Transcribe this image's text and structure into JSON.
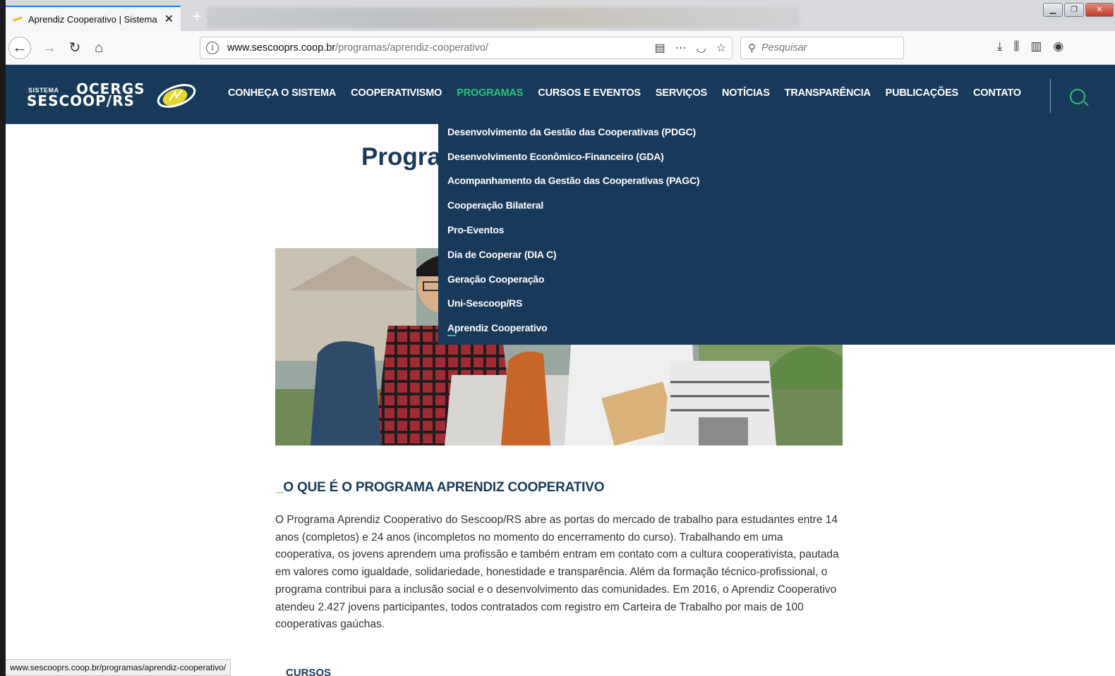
{
  "browser": {
    "tab_title": "Aprendiz Cooperativo | Sistema",
    "new_tab_label": "+",
    "url_domain": "www.sescooprs.coop.br",
    "url_path": "/programas/aprendiz-cooperativo/",
    "search_placeholder": "Pesquisar",
    "status_url": "www.sescooprs.coop.br/programas/aprendiz-cooperativo/"
  },
  "site": {
    "logo": {
      "sistema": "SISTEMA",
      "ocergs": "OCERGS",
      "sescoop": "SESCOOP/RS"
    },
    "nav": [
      {
        "label": "CONHEÇA O SISTEMA"
      },
      {
        "label": "COOPERATIVISMO"
      },
      {
        "label": "PROGRAMAS"
      },
      {
        "label": "CURSOS E EVENTOS"
      },
      {
        "label": "SERVIÇOS"
      },
      {
        "label": "NOTÍCIAS"
      },
      {
        "label": "TRANSPARÊNCIA"
      },
      {
        "label": "PUBLICAÇÕES"
      },
      {
        "label": "CONTATO"
      }
    ],
    "dropdown": [
      {
        "label": "Desenvolvimento da Gestão das Cooperativas (PDGC)"
      },
      {
        "label": "Desenvolvimento Econômico-Financeiro (GDA)"
      },
      {
        "label": "Acompanhamento da Gestão das Cooperativas (PAGC)"
      },
      {
        "label": "Cooperação Bilateral"
      },
      {
        "label": "Pro-Eventos"
      },
      {
        "label": "Dia de Cooperar (DIA C)"
      },
      {
        "label": "Geração Cooperação"
      },
      {
        "label": "Uni-Sescoop/RS"
      },
      {
        "label": "Aprendiz Cooperativo"
      }
    ],
    "colors": {
      "header": "#173a5b",
      "accent": "#2fc27a"
    }
  },
  "page": {
    "title_visible": "Progra",
    "section_dash": "_",
    "section_heading": "O QUE É O PROGRAMA APRENDIZ COOPERATIVO",
    "body": "O Programa Aprendiz Cooperativo do Sescoop/RS abre as portas do mercado de trabalho para estudantes entre 14 anos (completos) e 24 anos (incompletos no momento do encerramento do curso). Trabalhando em uma cooperativa, os jovens aprendem uma profissão e também entram em contato com a cultura cooperativista, pautada em valores como igualdade, solidariedade, honestidade e transparência. Além da formação técnico-profissional, o programa contribui para a inclusão social e o desenvolvimento das comunidades. Em 2016, o Aprendiz Cooperativo atendeu 2.427 jovens participantes, todos contratados com registro em Carteira de Trabalho por mais de 100 cooperativas gaúchas.",
    "next_heading_partial": "CURSOS"
  }
}
